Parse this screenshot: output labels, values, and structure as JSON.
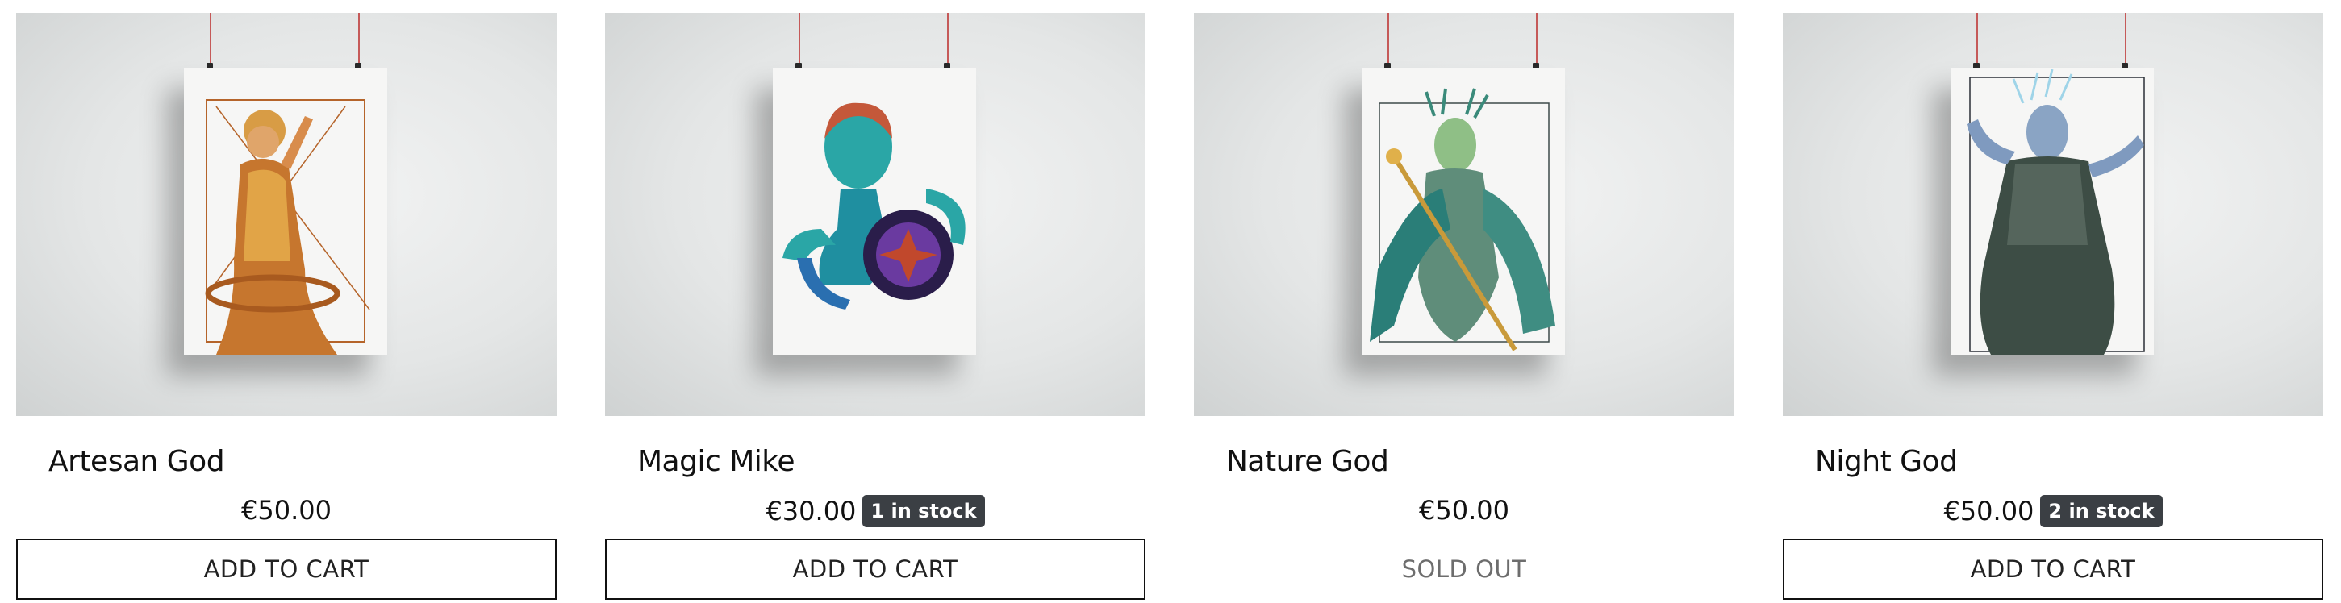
{
  "products": [
    {
      "title": "Artesan God",
      "price": "€50.00",
      "stock": "",
      "button": "ADD TO CART"
    },
    {
      "title": "Magic Mike",
      "price": "€30.00",
      "stock": "1 in stock",
      "button": "ADD TO CART"
    },
    {
      "title": "Nature God",
      "price": "€50.00",
      "stock": "",
      "button": "SOLD OUT"
    },
    {
      "title": "Night God",
      "price": "€50.00",
      "stock": "2 in stock",
      "button": "ADD TO CART"
    }
  ],
  "colors": {
    "stock_badge": "#3b3f44",
    "button_border": "#111111",
    "sold_out_text": "#6d6d6d"
  }
}
